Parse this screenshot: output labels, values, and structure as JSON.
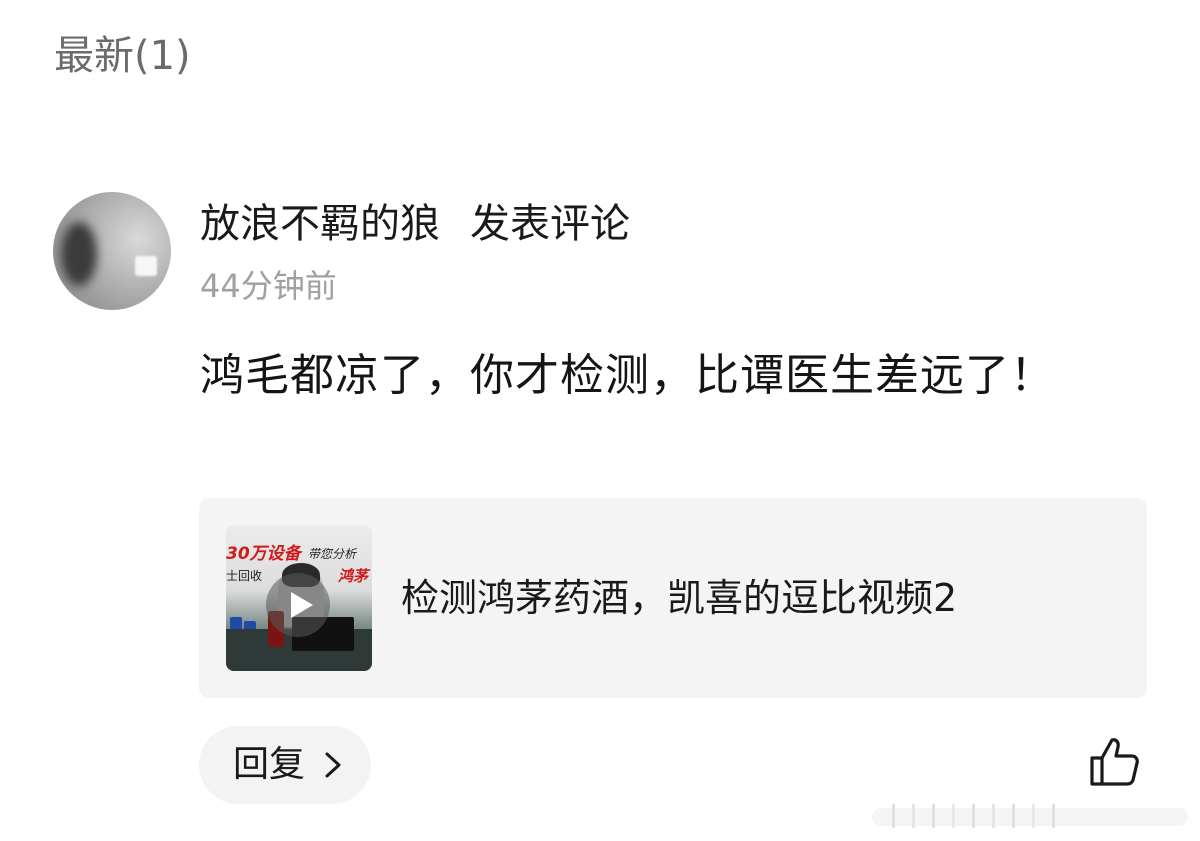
{
  "section": {
    "title": "最新(1)"
  },
  "comment": {
    "author": "放浪不羁的狼",
    "action": "发表评论",
    "time": "44分钟前",
    "text": "鸿毛都凉了，你才检测，比谭医生差远了！",
    "avatar_icon": "user-avatar"
  },
  "video_card": {
    "title": "检测鸿茅药酒，凯喜的逗比视频2",
    "thumbnail": {
      "overlay_text_1": "30万设备",
      "overlay_text_2": "带您分析",
      "overlay_text_3": "鸿茅",
      "overlay_text_4": "士回收",
      "play_icon": "play-icon"
    }
  },
  "actions": {
    "reply_label": "回复",
    "reply_icon": "chevron-right-icon",
    "like_icon": "thumbs-up-icon"
  }
}
